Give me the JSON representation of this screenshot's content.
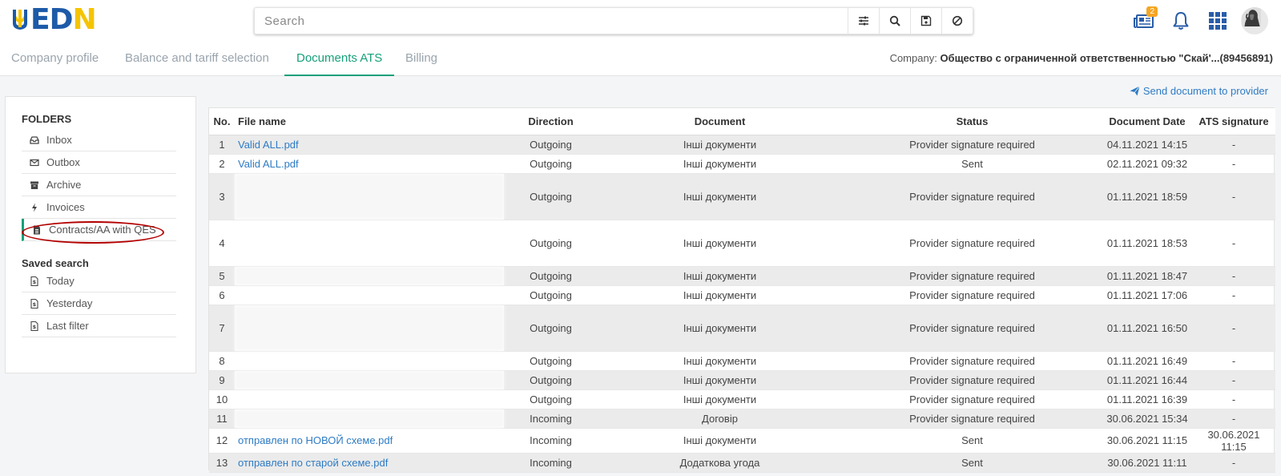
{
  "header": {
    "logo_text_blue": "ED",
    "logo_text_yellow": "N",
    "search_placeholder": "Search",
    "notifications_badge": "2",
    "icons": [
      "news-icon",
      "bell-icon",
      "apps-grid-icon",
      "avatar"
    ]
  },
  "tabs": [
    {
      "label": "Company profile",
      "active": false
    },
    {
      "label": "Balance and tariff selection",
      "active": false
    },
    {
      "label": "Documents ATS",
      "active": true
    },
    {
      "label": "Billing",
      "active": false
    }
  ],
  "company": {
    "label": "Company:",
    "value": "Общество с ограниченной ответственностью \"Скай'...(89456891)"
  },
  "sidebar": {
    "folders_title": "FOLDERS",
    "folders": [
      {
        "label": "Inbox",
        "icon": "inbox-icon"
      },
      {
        "label": "Outbox",
        "icon": "envelope-icon"
      },
      {
        "label": "Archive",
        "icon": "archive-icon"
      },
      {
        "label": "Invoices",
        "icon": "bolt-icon"
      },
      {
        "label": "Contracts/AA with QES",
        "icon": "document-icon"
      }
    ],
    "saved_title": "Saved search",
    "saved": [
      {
        "label": "Today",
        "icon": "saved-search-icon"
      },
      {
        "label": "Yesterday",
        "icon": "saved-search-icon"
      },
      {
        "label": "Last filter",
        "icon": "saved-search-icon"
      }
    ]
  },
  "send_link": "Send document to provider",
  "table": {
    "headers": [
      "No.",
      "File name",
      "Direction",
      "Document",
      "Status",
      "Document Date",
      "ATS signature"
    ],
    "rows": [
      {
        "no": "1",
        "file": "Valid ALL.pdf",
        "blur": false,
        "direction": "Outgoing",
        "document": "Інші документи",
        "status": "Provider signature required",
        "date": "04.11.2021 14:15",
        "sig": "-"
      },
      {
        "no": "2",
        "file": "Valid ALL.pdf",
        "blur": false,
        "direction": "Outgoing",
        "document": "Інші документи",
        "status": "Sent",
        "date": "02.11.2021 09:32",
        "sig": "-"
      },
      {
        "no": "3",
        "file": "",
        "blur": true,
        "direction": "Outgoing",
        "document": "Інші документи",
        "status": "Provider signature required",
        "date": "01.11.2021 18:59",
        "sig": "-"
      },
      {
        "no": "4",
        "file": "",
        "blur": true,
        "direction": "Outgoing",
        "document": "Інші документи",
        "status": "Provider signature required",
        "date": "01.11.2021 18:53",
        "sig": "-"
      },
      {
        "no": "5",
        "file": "",
        "blur": true,
        "direction": "Outgoing",
        "document": "Інші документи",
        "status": "Provider signature required",
        "date": "01.11.2021 18:47",
        "sig": "-"
      },
      {
        "no": "6",
        "file": "",
        "blur": true,
        "direction": "Outgoing",
        "document": "Інші документи",
        "status": "Provider signature required",
        "date": "01.11.2021 17:06",
        "sig": "-"
      },
      {
        "no": "7",
        "file": "",
        "blur": true,
        "direction": "Outgoing",
        "document": "Інші документи",
        "status": "Provider signature required",
        "date": "01.11.2021 16:50",
        "sig": "-"
      },
      {
        "no": "8",
        "file": "",
        "blur": true,
        "direction": "Outgoing",
        "document": "Інші документи",
        "status": "Provider signature required",
        "date": "01.11.2021 16:49",
        "sig": "-"
      },
      {
        "no": "9",
        "file": "",
        "blur": true,
        "direction": "Outgoing",
        "document": "Інші документи",
        "status": "Provider signature required",
        "date": "01.11.2021 16:44",
        "sig": "-"
      },
      {
        "no": "10",
        "file": "",
        "blur": true,
        "direction": "Outgoing",
        "document": "Інші документи",
        "status": "Provider signature required",
        "date": "01.11.2021 16:39",
        "sig": "-"
      },
      {
        "no": "11",
        "file": "",
        "blur": true,
        "direction": "Incoming",
        "document": "Договір",
        "status": "Provider signature required",
        "date": "30.06.2021 15:34",
        "sig": "-"
      },
      {
        "no": "12",
        "file": "отправлен по НОВОЙ схеме.pdf",
        "blur": false,
        "direction": "Incoming",
        "document": "Інші документи",
        "status": "Sent",
        "date": "30.06.2021 11:15",
        "sig": "30.06.2021 11:15"
      },
      {
        "no": "13",
        "file": "отправлен по старой схеме.pdf",
        "blur": false,
        "direction": "Incoming",
        "document": "Додаткова угода",
        "status": "Sent",
        "date": "30.06.2021 11:11",
        "sig": "-"
      }
    ]
  },
  "colors": {
    "accent": "#17a07a",
    "link": "#2e7bc4",
    "logo_blue": "#1d5aa8",
    "logo_yellow": "#f5c400",
    "highlight": "#b30000"
  }
}
